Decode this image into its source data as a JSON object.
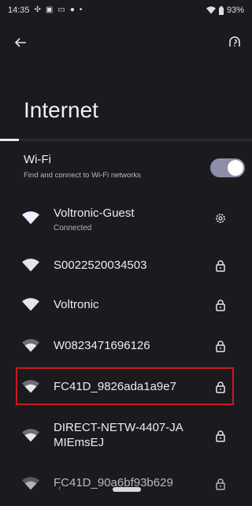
{
  "status_bar": {
    "time": "14:35",
    "battery": "93%",
    "left_icons": [
      "fan-icon",
      "message-icon",
      "notification-icon",
      "settings-dot-icon",
      "dot-icon"
    ],
    "right_icons": [
      "wifi-icon",
      "battery-icon"
    ]
  },
  "header": {
    "back_icon": "arrow-left-icon",
    "help_icon": "help-icon"
  },
  "title": "Internet",
  "wifi": {
    "label": "Wi-Fi",
    "sublabel": "Find and connect to Wi-Fi networks",
    "enabled": true
  },
  "networks": [
    {
      "name": "Voltronic-Guest",
      "status": "Connected",
      "action_icon": "gear-icon",
      "signal": "full"
    },
    {
      "name": "S0022520034503",
      "status": "",
      "action_icon": "lock-icon",
      "signal": "full"
    },
    {
      "name": "Voltronic",
      "status": "",
      "action_icon": "lock-icon",
      "signal": "full"
    },
    {
      "name": "W0823471696126",
      "status": "",
      "action_icon": "lock-icon",
      "signal": "medium"
    },
    {
      "name": "FC41D_9826ada1a9e7",
      "status": "",
      "action_icon": "lock-icon",
      "signal": "medium"
    },
    {
      "name_line1": "DIRECT-NETW-4407-JA",
      "name_line2": "MIEmsEJ",
      "status": "",
      "action_icon": "lock-icon",
      "signal": "medium"
    },
    {
      "name": "FC41D_90a6bf93b629",
      "status": "",
      "action_icon": "lock-icon",
      "signal": "medium"
    }
  ],
  "colors": {
    "background": "#1b1b1f",
    "highlight_border": "#d0161f",
    "toggle_track": "#8e8ea8"
  }
}
